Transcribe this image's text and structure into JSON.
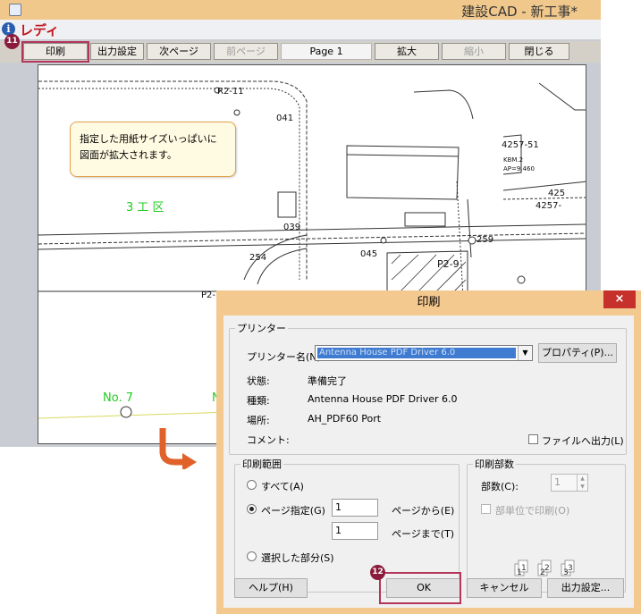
{
  "window": {
    "title": "建設CAD - 新工事*",
    "mode": "レディ",
    "info_glyph": "i"
  },
  "toolbar": {
    "print": "印刷",
    "output_settings": "出力設定",
    "next_page": "次ページ",
    "prev_page": "前ページ",
    "page": "Page 1",
    "zoom_in": "拡大",
    "zoom_out": "縮小",
    "close": "閉じる"
  },
  "badges": {
    "step11": "11",
    "step12": "12"
  },
  "note": "指定した用紙サイズいっぱいに図面が拡大されます。",
  "drawing": {
    "labels": [
      "R2-11",
      "041",
      "039",
      "254",
      "045",
      "P2-9",
      "259",
      "4257-51",
      "425",
      "4257-",
      "KBM.2",
      "AP=9.460",
      "P2-",
      "3 工 区",
      "No. 7",
      "N"
    ]
  },
  "dialog": {
    "title": "印刷",
    "close": "×",
    "printer_group": "プリンター",
    "printer_name_label": "プリンター名(N):",
    "printer_name_value": "Antenna House PDF Driver 6.0",
    "properties_button": "プロパティ(P)...",
    "status_label": "状態:",
    "status_value": "準備完了",
    "type_label": "種類:",
    "type_value": "Antenna House PDF Driver 6.0",
    "location_label": "場所:",
    "location_value": "AH_PDF60 Port",
    "comment_label": "コメント:",
    "print_to_file": "ファイルへ出力(L)",
    "range_group": "印刷範囲",
    "range_all": "すべて(A)",
    "range_pages": "ページ指定(G)",
    "from_value": "1",
    "from_label": "ページから(E)",
    "to_value": "1",
    "to_label": "ページまで(T)",
    "range_selection": "選択した部分(S)",
    "copies_group": "印刷部数",
    "copies_label": "部数(C):",
    "copies_value": "1",
    "collate": "部単位で印刷(O)",
    "help_button": "ヘルプ(H)",
    "ok_button": "OK",
    "cancel_button": "キャンセル",
    "output_settings_button": "出力設定..."
  },
  "colors": {
    "title_bar": "#f1c88c",
    "highlight": "#b3365a",
    "badge": "#8b1b3d",
    "mode_text": "#c0141c",
    "zone_label": "#22cc22"
  },
  "icons": [
    "app-icon",
    "info-icon",
    "curved-arrow-icon",
    "dropdown-arrow-icon",
    "copies-collate-icon"
  ]
}
